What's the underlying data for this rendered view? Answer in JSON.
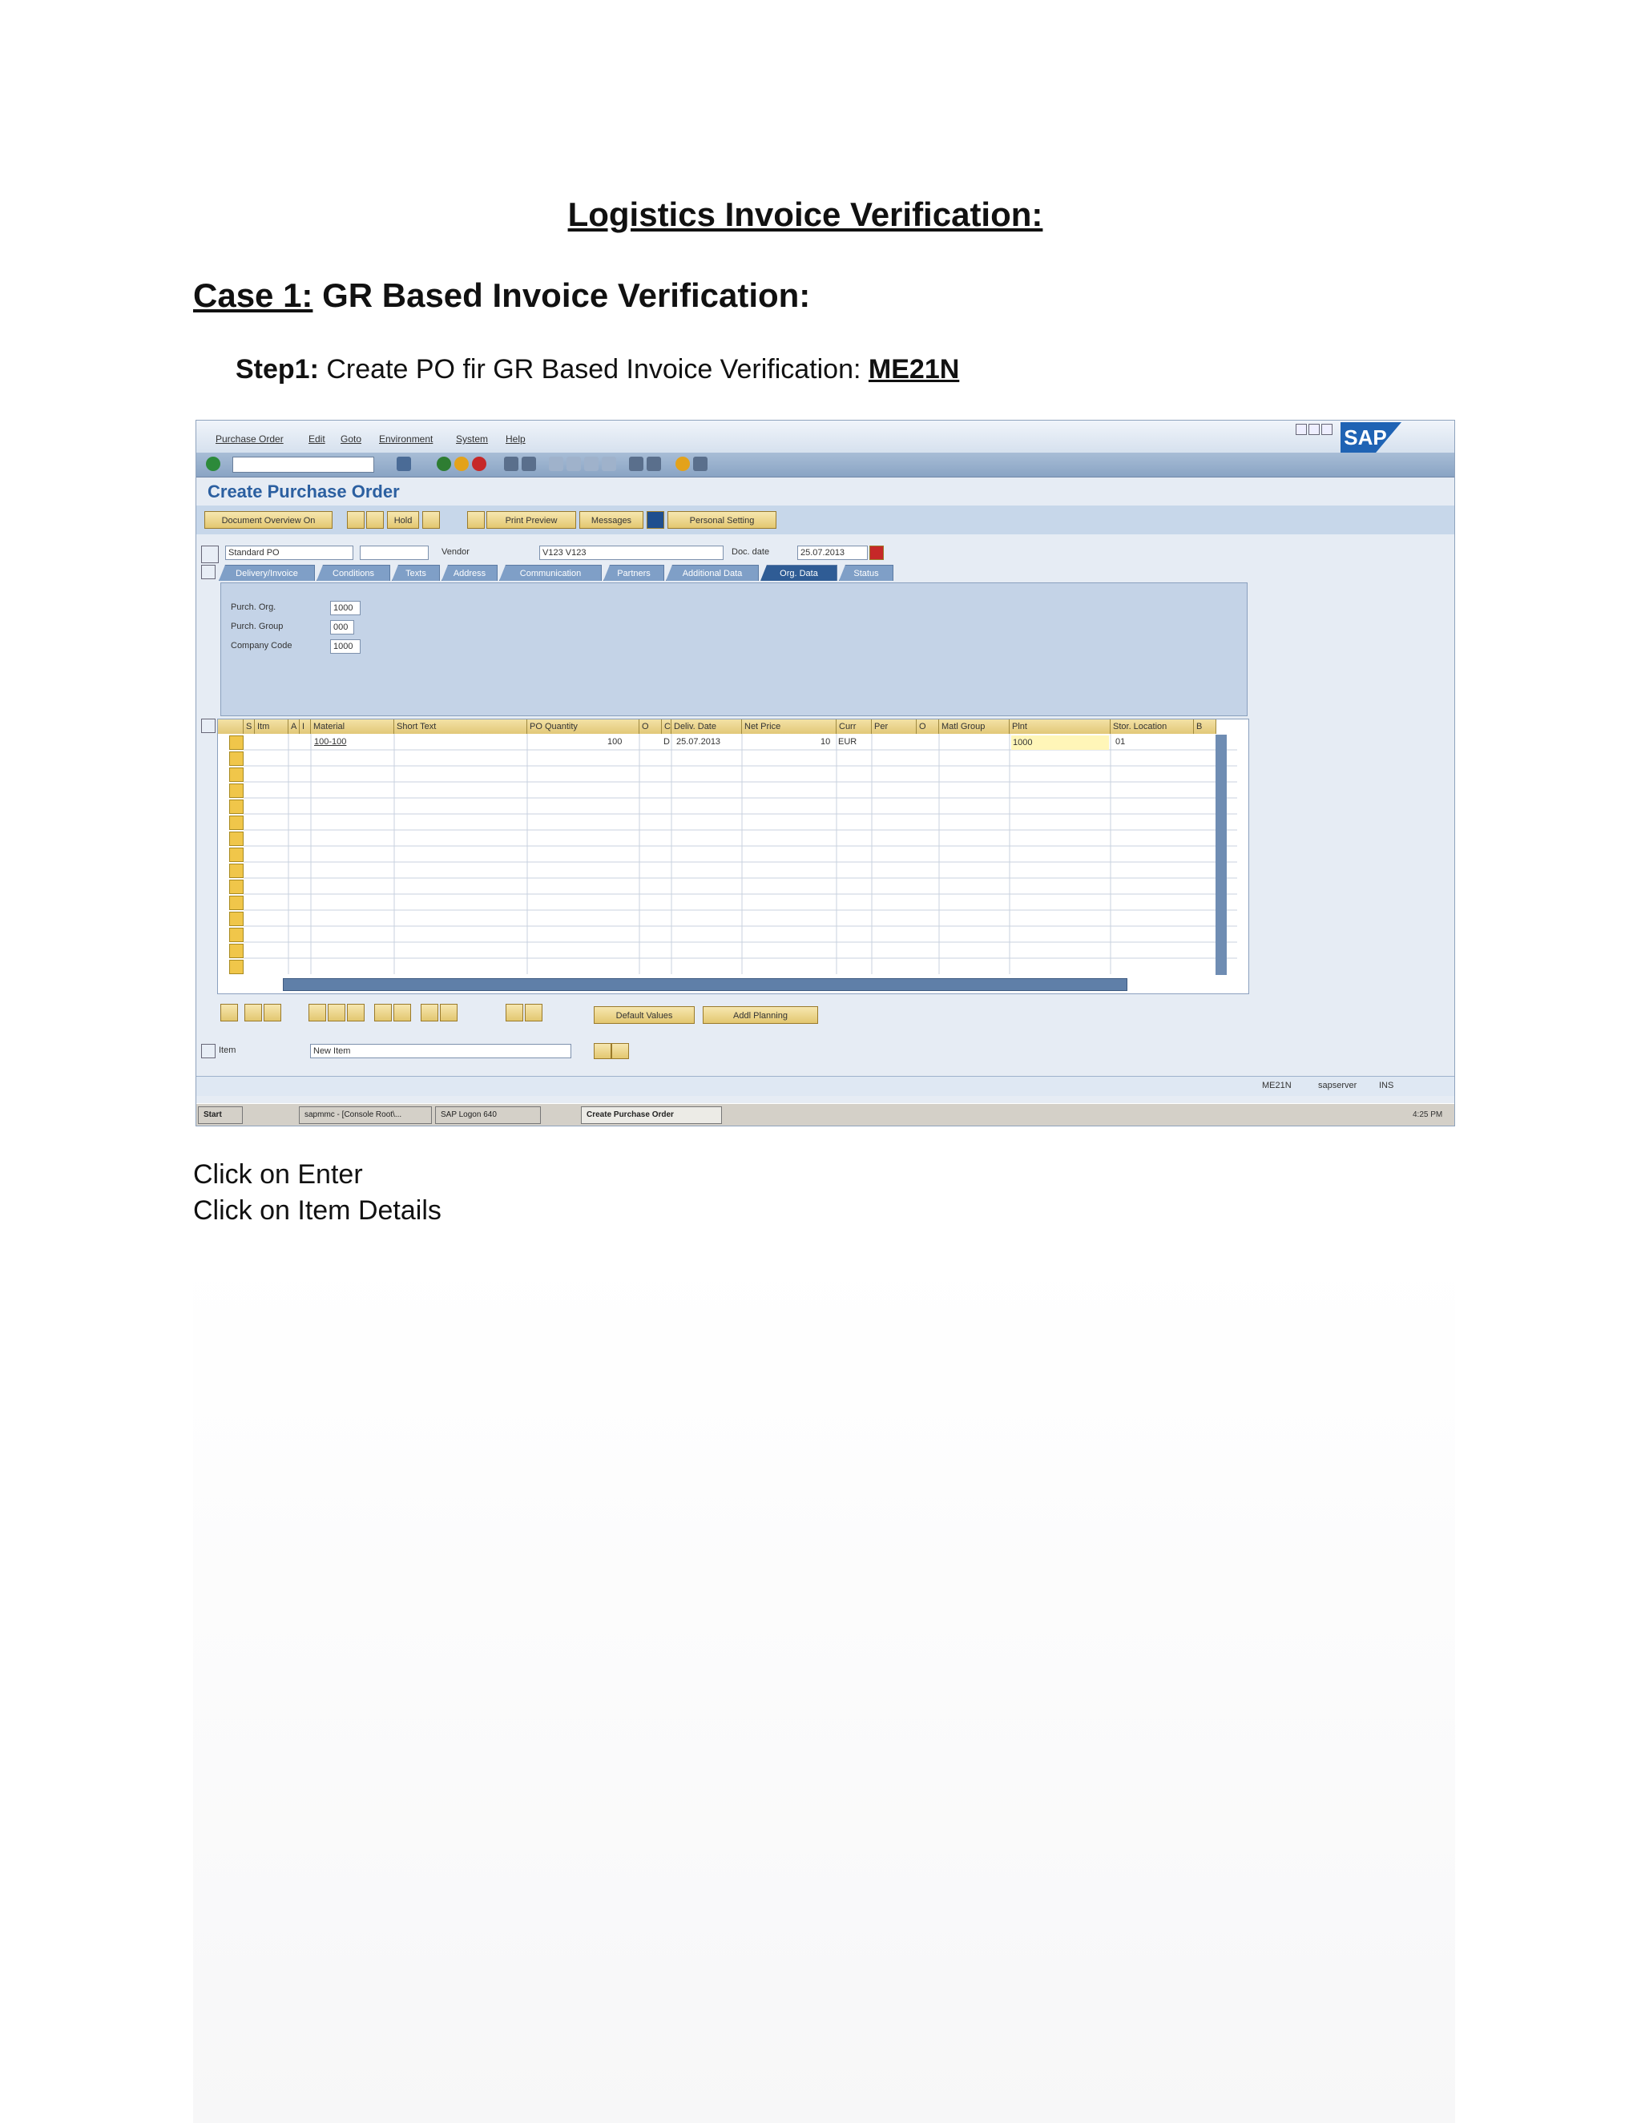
{
  "document": {
    "title": "Logistics Invoice Verification:",
    "case_label": "Case 1:",
    "case_title": "GR Based Invoice Verification:",
    "step_label": "Step1:",
    "step_text": "Create PO fir GR Based Invoice Verification:",
    "step_tcode": "ME21N",
    "instructions": [
      "Click on Enter",
      "Click on Item Details"
    ]
  },
  "sap": {
    "menu": [
      "Purchase Order",
      "Edit",
      "Goto",
      "Environment",
      "System",
      "Help"
    ],
    "logo": "SAP",
    "screen_title": "Create Purchase Order",
    "app_buttons": {
      "doc_overview": "Document Overview On",
      "hold": "Hold",
      "print_preview": "Print Preview",
      "messages": "Messages",
      "personal_setting": "Personal Setting"
    },
    "header": {
      "po_type": "Standard PO",
      "vendor_label": "Vendor",
      "vendor_value": "V123 V123",
      "doc_date_label": "Doc. date",
      "doc_date_value": "25.07.2013"
    },
    "tabs": [
      "Delivery/Invoice",
      "Conditions",
      "Texts",
      "Address",
      "Communication",
      "Partners",
      "Additional Data",
      "Org. Data",
      "Status"
    ],
    "org_data": {
      "purch_org_label": "Purch. Org.",
      "purch_org_value": "1000",
      "purch_group_label": "Purch. Group",
      "purch_group_value": "000",
      "company_code_label": "Company Code",
      "company_code_value": "1000"
    },
    "grid": {
      "columns": [
        "S",
        "Itm",
        "A",
        "I",
        "Material",
        "Short Text",
        "PO Quantity",
        "O",
        "C",
        "Deliv. Date",
        "Net Price",
        "Curr",
        "Per",
        "O",
        "Matl Group",
        "Plnt",
        "Stor. Location",
        "B"
      ],
      "row": {
        "material": "100-100",
        "po_quantity": "100",
        "c": "D",
        "deliv_date": "25.07.2013",
        "net_price": "10",
        "curr": "EUR",
        "plant": "1000",
        "stor_location": "01"
      }
    },
    "bottom_buttons": {
      "default_values": "Default Values",
      "addl_planning": "Addl Planning"
    },
    "item_label": "Item",
    "item_value": "New Item",
    "status": {
      "tcode": "ME21N",
      "server": "sapserver",
      "mode": "INS"
    },
    "taskbar": {
      "start": "Start",
      "tasks": [
        "sapmmc - [Console Root\\...",
        "SAP Logon 640",
        "Create Purchase Order"
      ],
      "clock": "4:25 PM"
    }
  }
}
